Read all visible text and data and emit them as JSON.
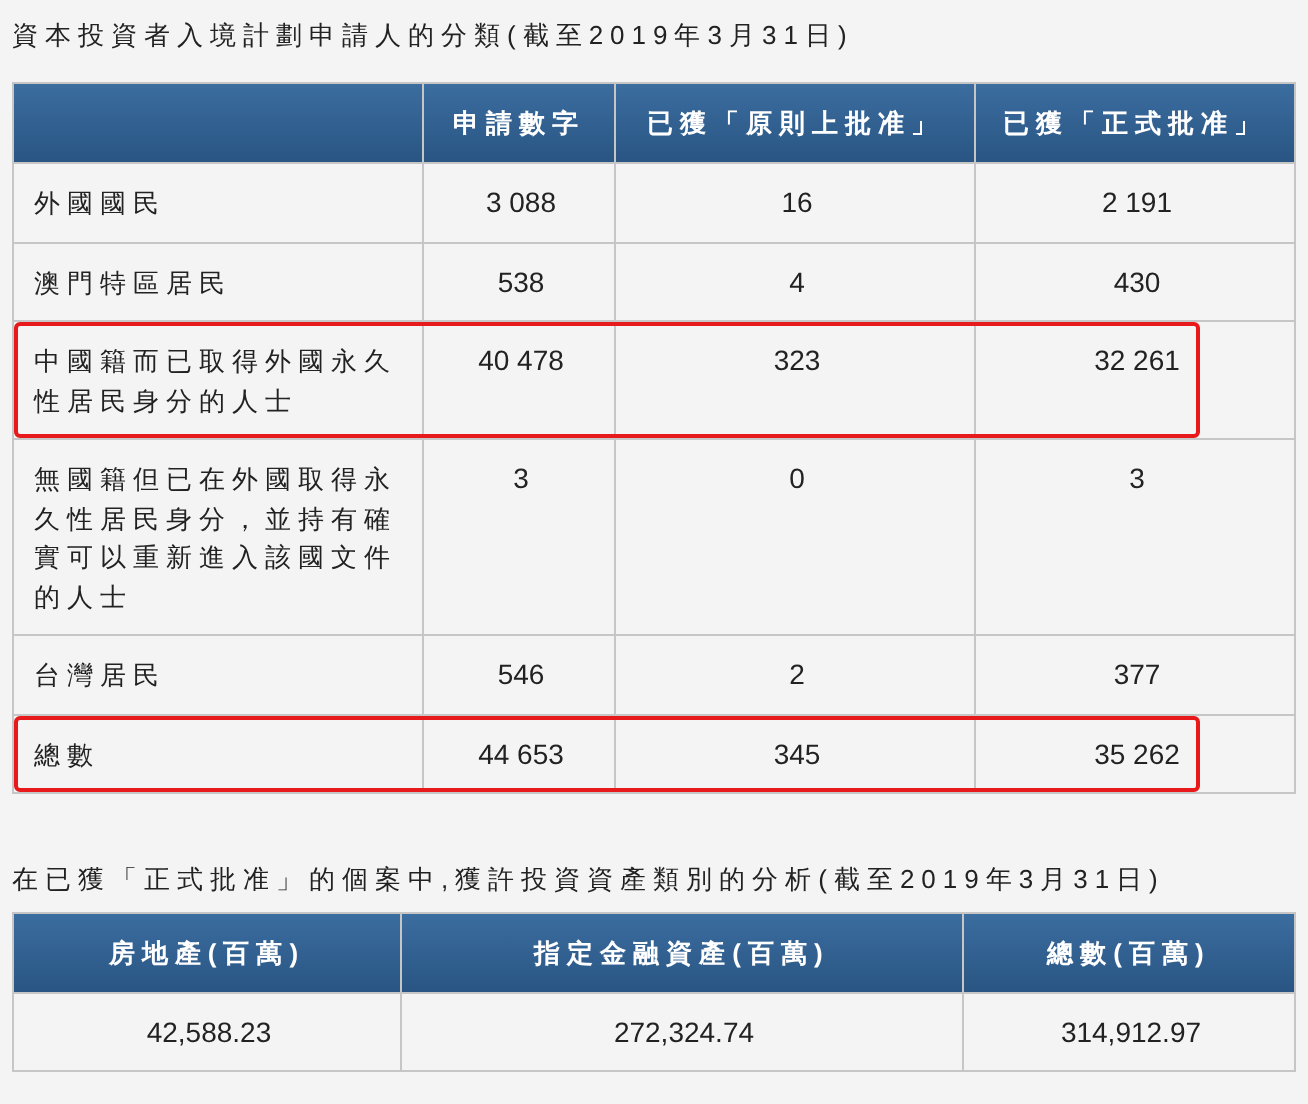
{
  "table1": {
    "title": "資本投資者入境計劃申請人的分類(截至2019年3月31日)",
    "columns": [
      "",
      "申請數字",
      "已獲「原則上批准」",
      "已獲「正式批准」"
    ],
    "rows": [
      {
        "cells": [
          "外國國民",
          "3 088",
          "16",
          "2 191"
        ],
        "highlighted": false
      },
      {
        "cells": [
          "澳門特區居民",
          "538",
          "4",
          "430"
        ],
        "highlighted": false
      },
      {
        "cells": [
          "中國籍而已取得外國永久性居民身分的人士",
          "40 478",
          "323",
          "32 261"
        ],
        "highlighted": true
      },
      {
        "cells": [
          "無國籍但已在外國取得永久性居民身分，並持有確實可以重新進入該國文件的人士",
          "3",
          "0",
          "3"
        ],
        "highlighted": false
      },
      {
        "cells": [
          "台灣居民",
          "546",
          "2",
          "377"
        ],
        "highlighted": false
      },
      {
        "cells": [
          "總數",
          "44 653",
          "345",
          "35 262"
        ],
        "highlighted": true
      }
    ]
  },
  "table2": {
    "title": "在已獲「正式批准」的個案中,獲許投資資產類別的分析(截至2019年3月31日)",
    "columns": [
      "房地產(百萬)",
      "指定金融資產(百萬)",
      "總數(百萬)"
    ],
    "rows": [
      {
        "cells": [
          "42,588.23",
          "272,324.74",
          "314,912.97"
        ]
      }
    ]
  }
}
